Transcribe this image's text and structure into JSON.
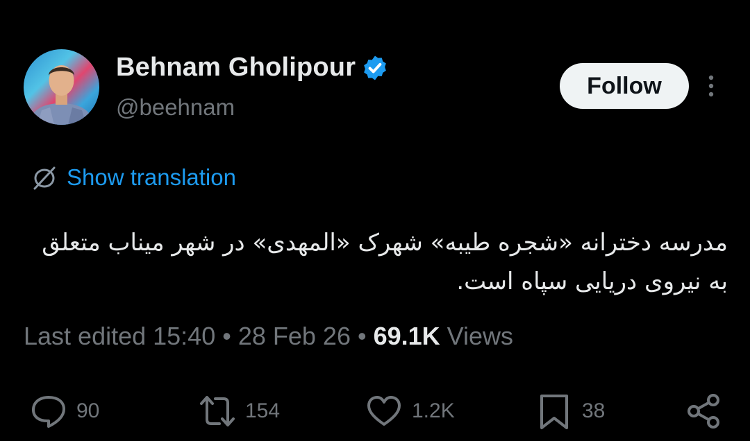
{
  "author": {
    "name": "Behnam Gholipour",
    "handle": "@beehnam",
    "verified": true
  },
  "follow_label": "Follow",
  "translation_label": "Show translation",
  "tweet_text": "مدرسه دخترانه «شجره طیبه» شهرک «المهدی» در شهر میناب متعلق به نیروی دریایی سپاه است.",
  "meta": {
    "last_edited": "Last edited 15:40",
    "separator": "•",
    "date": "28 Feb 26",
    "views_count": "69.1K",
    "views_label": "Views"
  },
  "actions": {
    "replies": "90",
    "reposts": "154",
    "likes": "1.2K",
    "bookmarks": "38"
  },
  "colors": {
    "background": "#000000",
    "text": "#e7e9ea",
    "muted": "#71767b",
    "accent": "#1d9bf0"
  },
  "icons": [
    "verified-badge-icon",
    "more-icon",
    "translate-icon",
    "reply-icon",
    "repost-icon",
    "like-icon",
    "bookmark-icon",
    "share-icon"
  ]
}
